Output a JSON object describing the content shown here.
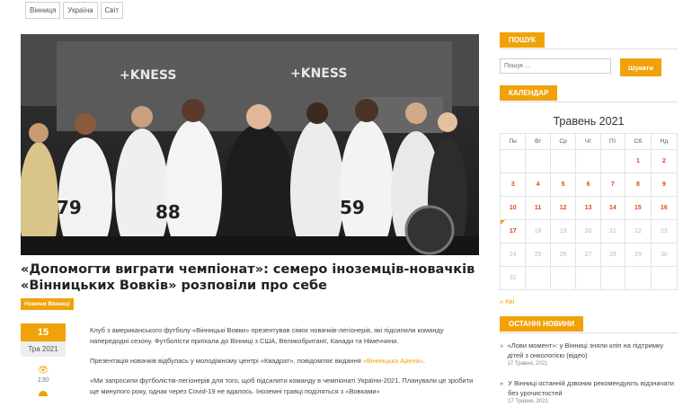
{
  "topnav": [
    "Вінниця",
    "Україна",
    "Світ"
  ],
  "hero": {
    "banner_text": "+KNESS",
    "jersey_numbers": [
      "79",
      "88",
      "59"
    ]
  },
  "article": {
    "title": "«Допомогти виграти чемпіонат»: семеро іноземців-новачків «Вінницьких Вовків» розповіли про себе",
    "category": "Новини Вінниці",
    "date_day": "15",
    "date_month": "Тра 2021",
    "views": "130",
    "p1": "Клуб з американського футболу «Вінницькі Вовки» презентував сімох новачків-легіонерів, які підсилили команду напередодні сезону. Футболісти приїхали до Вінниці з США, Великобританії, Канади та Німеччини.",
    "p2_before": "Презентація новачків відбулась у молодіжному центрі «Квадрат», повідомляє видання ",
    "p2_link": "«Вінницька Арена»",
    "p2_after": ".",
    "p3": "«Ми запросили футболістів-легіонерів для того, щоб підсилити команду в чемпіонаті України-2021. Планували це зробити ще минулого року, однак через Covid-19 не вдалось. Іноземні гравці поділяться з «Вовками»"
  },
  "sidebar": {
    "search_title": "ПОШУК",
    "search_placeholder": "Пошук ...",
    "search_button": "Шукати",
    "calendar_title": "КАЛЕНДАР",
    "calendar_caption": "Травень 2021",
    "weekdays": [
      "Пн",
      "Вт",
      "Ср",
      "Чт",
      "Пт",
      "Сб",
      "Нд"
    ],
    "weeks": [
      [
        "",
        "",
        "",
        "",
        "",
        "1",
        "2"
      ],
      [
        "3",
        "4",
        "5",
        "6",
        "7",
        "8",
        "9"
      ],
      [
        "10",
        "11",
        "12",
        "13",
        "14",
        "15",
        "16"
      ],
      [
        "17",
        "18",
        "19",
        "20",
        "21",
        "22",
        "23"
      ],
      [
        "24",
        "25",
        "26",
        "27",
        "28",
        "29",
        "30"
      ],
      [
        "31",
        "",
        "",
        "",
        "",
        "",
        ""
      ]
    ],
    "prev_month_link": "« Кві",
    "latest_title": "ОСТАННІ НОВИНИ",
    "latest": [
      {
        "title": "«Лови момент»: у Вінниці зняли кліп на підтримку дітей з онкологією (відео)",
        "date": "17 Травня, 2021"
      },
      {
        "title": "У Вінниці останній дзвоник рекомендують відзначати без урочистостей",
        "date": "17 Травня, 2021"
      }
    ]
  },
  "colors": {
    "accent": "#f1a20a",
    "link_red": "#e1461b"
  }
}
